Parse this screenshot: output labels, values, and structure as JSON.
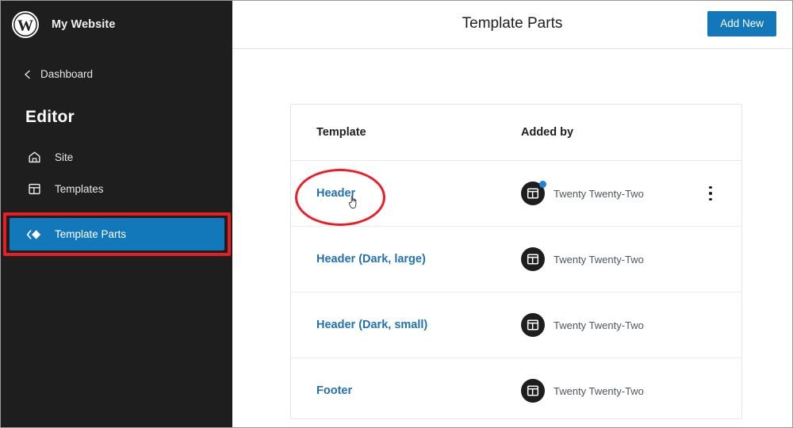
{
  "sidebar": {
    "logo_icon": "wordpress-logo-icon",
    "site_title": "My Website",
    "back": {
      "icon": "chevron-left-icon",
      "label": "Dashboard"
    },
    "section_title": "Editor",
    "items": [
      {
        "label": "Site",
        "icon": "home-icon",
        "active": false
      },
      {
        "label": "Templates",
        "icon": "layout-icon",
        "active": false
      },
      {
        "label": "Template Parts",
        "icon": "template-part-diamond-icon",
        "active": true
      }
    ],
    "active_color": "#1278ba",
    "background_color": "#1e1e1e"
  },
  "header": {
    "title": "Template Parts",
    "add_new_label": "Add New",
    "add_new_color": "#1278ba"
  },
  "table": {
    "columns": [
      "Template",
      "Added by"
    ],
    "rows": [
      {
        "template": "Header",
        "added_by": "Twenty Twenty-Two",
        "avatar_icon": "theme-layout-icon",
        "has_notification_dot": true,
        "kebab_icon": "more-vertical-icon",
        "show_kebab": true
      },
      {
        "template": "Header (Dark, large)",
        "added_by": "Twenty Twenty-Two",
        "avatar_icon": "theme-layout-icon",
        "has_notification_dot": false,
        "kebab_icon": "more-vertical-icon",
        "show_kebab": false
      },
      {
        "template": "Header (Dark, small)",
        "added_by": "Twenty Twenty-Two",
        "avatar_icon": "theme-layout-icon",
        "has_notification_dot": false,
        "kebab_icon": "more-vertical-icon",
        "show_kebab": false
      },
      {
        "template": "Footer",
        "added_by": "Twenty Twenty-Two",
        "avatar_icon": "theme-layout-icon",
        "has_notification_dot": false,
        "kebab_icon": "more-vertical-icon",
        "show_kebab": false
      }
    ],
    "link_color": "#2271b1"
  },
  "annotations": {
    "highlight_color": "#ec1c24",
    "ellipse_target": "Header",
    "box_target": "Template Parts",
    "cursor_icon": "pointer-hand-cursor-icon"
  }
}
